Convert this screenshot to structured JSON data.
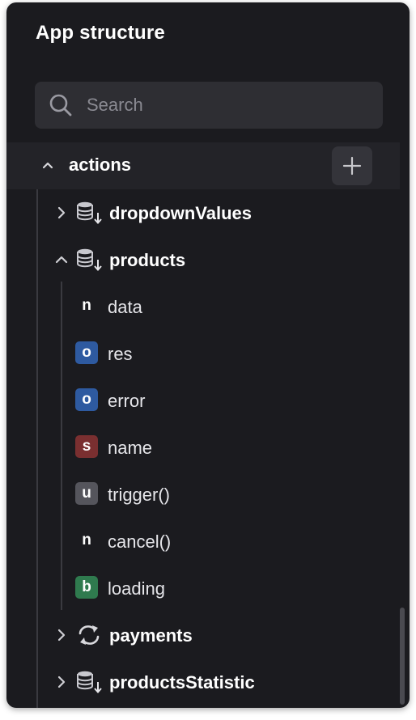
{
  "panel": {
    "title": "App structure"
  },
  "search": {
    "placeholder": "Search",
    "value": ""
  },
  "tree": {
    "root": {
      "label": "actions",
      "expanded": true,
      "icon": "chevron-up-icon",
      "action_icon": "plus-icon"
    },
    "items": [
      {
        "label": "dropdownValues",
        "expanded": false,
        "icon": "database-query-icon"
      },
      {
        "label": "products",
        "expanded": true,
        "icon": "database-query-icon"
      },
      {
        "label": "payments",
        "expanded": false,
        "icon": "refresh-icon"
      },
      {
        "label": "productsStatistic",
        "expanded": false,
        "icon": "database-query-icon"
      }
    ],
    "products_children": [
      {
        "type": "n",
        "label": "data",
        "badge_color": ""
      },
      {
        "type": "o",
        "label": "res",
        "badge_color": "#2e5aa0"
      },
      {
        "type": "o",
        "label": "error",
        "badge_color": "#2e5aa0"
      },
      {
        "type": "s",
        "label": "name",
        "badge_color": "#7a2f30"
      },
      {
        "type": "u",
        "label": "trigger()",
        "badge_color": "#55555c"
      },
      {
        "type": "n",
        "label": "cancel()",
        "badge_color": ""
      },
      {
        "type": "b",
        "label": "loading",
        "badge_color": "#2f7a4e"
      }
    ]
  },
  "colors": {
    "panel_bg": "#1b1b1f",
    "search_bg": "#2e2e33",
    "selected_row_bg": "#232328",
    "object_badge": "#2e5aa0",
    "string_badge": "#7a2f30",
    "undefined_badge": "#55555c",
    "boolean_badge": "#2f7a4e"
  }
}
